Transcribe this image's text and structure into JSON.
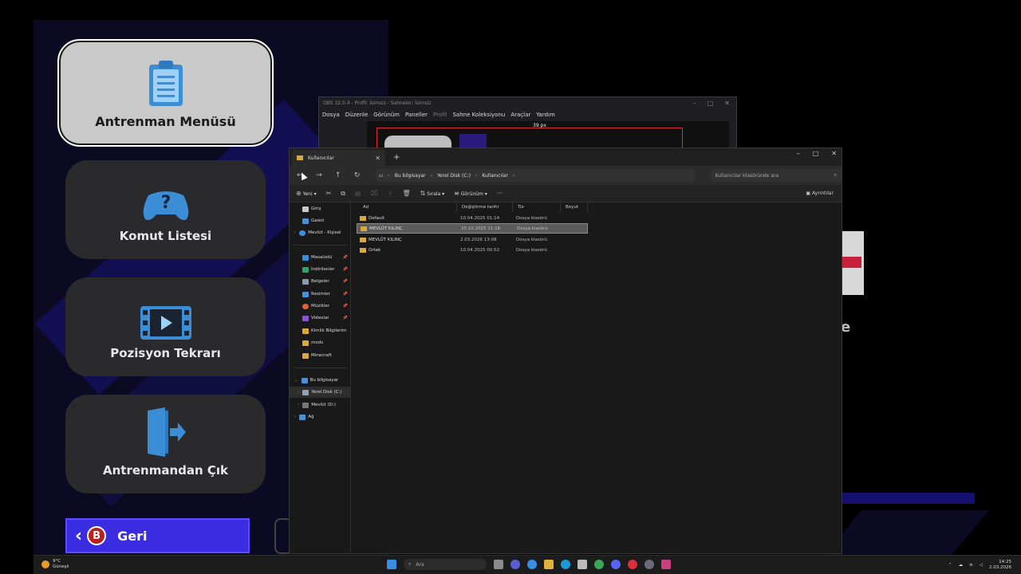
{
  "game_menu": {
    "items": [
      {
        "label": "Antrenman Menüsü",
        "icon": "clipboard-icon",
        "active": true
      },
      {
        "label": "Komut Listesi",
        "icon": "gamepad-question-icon",
        "active": false
      },
      {
        "label": "Pozisyon Tekrarı",
        "icon": "film-play-icon",
        "active": false
      },
      {
        "label": "Antrenmandan Çık",
        "icon": "exit-door-icon",
        "active": false
      }
    ],
    "back": {
      "button_glyph": "B",
      "label": "Geri"
    },
    "right_fragment_text": "e"
  },
  "obs": {
    "title": "OBS 32.0.4 - Profil: İsimsiz - Sahneler: İsimsiz",
    "menu": [
      "Dosya",
      "Düzenle",
      "Görünüm",
      "Paneller",
      "Profil",
      "Sahne Koleksiyonu",
      "Araçlar",
      "Yardım"
    ],
    "dimmed_menu": "Profil",
    "canvas_label": "39 px"
  },
  "explorer": {
    "tab_title": "Kullanıcılar",
    "breadcrumb": [
      "Bu bilgisayar",
      "Yerel Disk (C:)",
      "Kullanıcılar"
    ],
    "search_placeholder": "Kullanıcılar klasöründe ara",
    "toolbar": {
      "new": "Yeni",
      "sort": "Sırala",
      "view": "Görünüm",
      "details": "Ayrıntılar"
    },
    "columns": [
      "Ad",
      "Değiştirme tarihi",
      "Tür",
      "Boyut"
    ],
    "rows": [
      {
        "name": "Default",
        "date": "10.04.2025 01:14",
        "type": "Dosya klasörü",
        "selected": false
      },
      {
        "name": "MEVLÜT KILINÇ",
        "date": "25.10.2025 11:18",
        "type": "Dosya klasörü",
        "selected": true
      },
      {
        "name": "MEVLÜT KILINÇ",
        "date": "2.03.2026 13:08",
        "type": "Dosya klasörü",
        "selected": false
      },
      {
        "name": "Ortak",
        "date": "10.04.2025 00:52",
        "type": "Dosya klasörü",
        "selected": false
      }
    ],
    "nav": {
      "home": "Giriş",
      "gallery": "Galeri",
      "onedrive": "Mevlüt - Kişisel",
      "quick": [
        "Masaüstü",
        "İndirilenler",
        "Belgeler",
        "Resimler",
        "Müzikler",
        "Videolar",
        "Kimlik Bilgilerim",
        "mods",
        "Minecraft"
      ],
      "this_pc": "Bu bilgisayar",
      "drives": [
        "Yerel Disk (C:)",
        "Mevlüt (D:)"
      ],
      "network": "Ağ"
    }
  },
  "taskbar": {
    "weather_temp": "9°C",
    "weather_desc": "Güneşli",
    "search_placeholder": "Ara",
    "time": "14:25",
    "date": "2.03.2026"
  }
}
